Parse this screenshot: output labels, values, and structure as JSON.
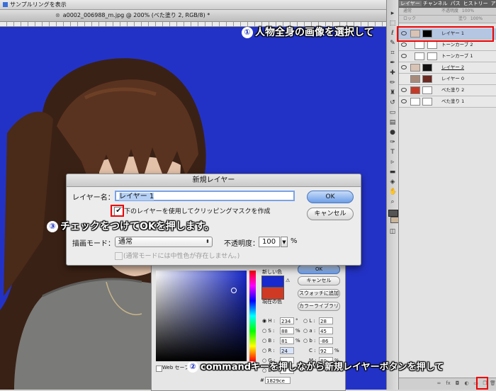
{
  "options_bar": {
    "checkbox_label": "サンプルリングを表示"
  },
  "document_tab": {
    "title": "a0002_006988_m.jpg @ 200% (べた塗り 2, RGB/8) *"
  },
  "layers_panel": {
    "tabs": [
      "レイヤー",
      "チャンネル",
      "パス",
      "ヒストリー",
      "アクション"
    ],
    "blend_mode": "通常",
    "opacity_label": "不透明度",
    "opacity_value": "100%",
    "lock_label": "ロック",
    "fill_label": "塗り",
    "fill_value": "100%",
    "layers": [
      {
        "name": "レイヤー 1",
        "selected": true
      },
      {
        "name": "トーンカーブ 2",
        "selected": false
      },
      {
        "name": "トーンカーブ 1",
        "selected": false
      },
      {
        "name": "レイヤー 2",
        "selected": false
      },
      {
        "name": "レイヤー 0",
        "selected": false
      },
      {
        "name": "べた塗り 2",
        "selected": false
      },
      {
        "name": "べた塗り 1",
        "selected": false
      }
    ]
  },
  "new_layer_dialog": {
    "title": "新規レイヤー",
    "name_label": "レイヤー名：",
    "name_value": "レイヤー 1",
    "clip_checkbox_label": "下のレイヤーを使用してクリッピングマスクを作成",
    "clip_checked": true,
    "mode_label": "描画モード：",
    "mode_value": "通常",
    "opacity_label": "不透明度：",
    "opacity_value": "100",
    "opacity_unit": "%",
    "neutral_label": "(通常モードには中性色が存在しません。)",
    "ok_label": "OK",
    "cancel_label": "キャンセル"
  },
  "color_picker": {
    "ok_label": "OK",
    "cancel_label": "キャンセル",
    "add_swatch_label": "スウォッチに追加",
    "color_library_label": "カラーライブラリ",
    "new_label": "新しい色",
    "current_label": "現在の色",
    "web_only_label": "Web セーフカ",
    "fields": {
      "H": "234",
      "S": "88",
      "B": "81",
      "R": "24",
      "G": "",
      "B2": "",
      "L": "28",
      "a": "45",
      "b": "-86",
      "C": "92",
      "M": "80",
      "Y": "",
      "K": ""
    },
    "units": {
      "H": "°",
      "S": "%",
      "B": "%",
      "C": "%",
      "M": "%"
    },
    "hex": "1829ce",
    "colors": {
      "new": "#1829ce",
      "current": "#cf3a24"
    }
  },
  "annotations": {
    "step1": {
      "num": "①",
      "text": "人物全身の画像を選択して"
    },
    "step2": {
      "num": "②",
      "text": "commandキーを押しながら新規レイヤーボタンを押して"
    },
    "step3": {
      "num": "③",
      "text": "チェックをつけてOKを押します。"
    }
  },
  "colors": {
    "canvas_bg": "#2332c6",
    "highlight": "#e00000",
    "selected_layer": "#b5c6e3"
  }
}
